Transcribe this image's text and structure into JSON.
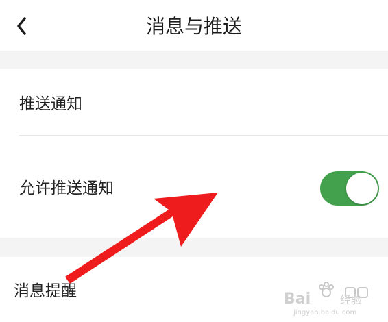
{
  "header": {
    "back_icon": "chevron-left-icon",
    "title": "消息与推送"
  },
  "sections": {
    "push_header": {
      "label": "推送通知"
    },
    "allow_push": {
      "label": "允许推送通知",
      "toggle_on": true,
      "toggle_color": "#43a14d"
    },
    "reminder": {
      "label": "消息提醒"
    }
  },
  "annotation": {
    "arrow_color": "#ee1c1c",
    "arrow_icon": "red-arrow-pointer"
  },
  "watermark": {
    "brand": "Baidu经验",
    "url": "jingyan.baidu.com"
  }
}
